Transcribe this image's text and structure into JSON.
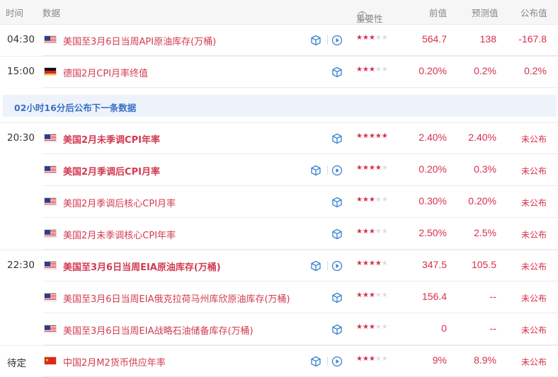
{
  "header": {
    "time": "时间",
    "data": "数据",
    "importance": "重要性",
    "help": "?",
    "previous": "前值",
    "forecast": "预测值",
    "actual": "公布值"
  },
  "banner": "02小时16分后公布下一条数据",
  "colors": {
    "accent": "#d6304c",
    "link": "#3a6fc4",
    "star_off": "#dddddd"
  },
  "rows": [
    {
      "time": "04:30",
      "flag": "us-flag",
      "name": "美国至3月6日当周API原油库存(万桶)",
      "bold": false,
      "stars": 3,
      "play": true,
      "previous": "564.7",
      "forecast": "138",
      "actual": "-167.8"
    },
    {
      "time": "15:00",
      "flag": "de-flag",
      "name": "德国2月CPI月率终值",
      "bold": false,
      "stars": 3,
      "play": false,
      "previous": "0.20%",
      "forecast": "0.2%",
      "actual": "0.2%"
    },
    {
      "time": "20:30",
      "flag": "us-flag",
      "name": "美国2月未季调CPI年率",
      "bold": true,
      "stars": 5,
      "play": false,
      "previous": "2.40%",
      "forecast": "2.40%",
      "actual": "未公布"
    },
    {
      "time": "",
      "flag": "us-flag",
      "name": "美国2月季调后CPI月率",
      "bold": true,
      "stars": 4,
      "play": true,
      "previous": "0.20%",
      "forecast": "0.3%",
      "actual": "未公布"
    },
    {
      "time": "",
      "flag": "us-flag",
      "name": "美国2月季调后核心CPI月率",
      "bold": false,
      "stars": 3,
      "play": false,
      "previous": "0.30%",
      "forecast": "0.20%",
      "actual": "未公布"
    },
    {
      "time": "",
      "flag": "us-flag",
      "name": "美国2月未季调核心CPI年率",
      "bold": false,
      "stars": 3,
      "play": false,
      "previous": "2.50%",
      "forecast": "2.5%",
      "actual": "未公布"
    },
    {
      "time": "22:30",
      "flag": "us-flag",
      "name": "美国至3月6日当周EIA原油库存(万桶)",
      "bold": true,
      "stars": 4,
      "play": true,
      "previous": "347.5",
      "forecast": "105.5",
      "actual": "未公布"
    },
    {
      "time": "",
      "flag": "us-flag",
      "name": "美国至3月6日当周EIA俄克拉荷马州库欣原油库存(万桶)",
      "bold": false,
      "stars": 3,
      "play": false,
      "previous": "156.4",
      "forecast": "--",
      "actual": "未公布"
    },
    {
      "time": "",
      "flag": "us-flag",
      "name": "美国至3月6日当周EIA战略石油储备库存(万桶)",
      "bold": false,
      "stars": 3,
      "play": false,
      "previous": "0",
      "forecast": "--",
      "actual": "未公布"
    },
    {
      "time": "待定",
      "flag": "cn-flag",
      "name": "中国2月M2货币供应年率",
      "bold": false,
      "stars": 3,
      "play": true,
      "previous": "9%",
      "forecast": "8.9%",
      "actual": "未公布"
    }
  ]
}
